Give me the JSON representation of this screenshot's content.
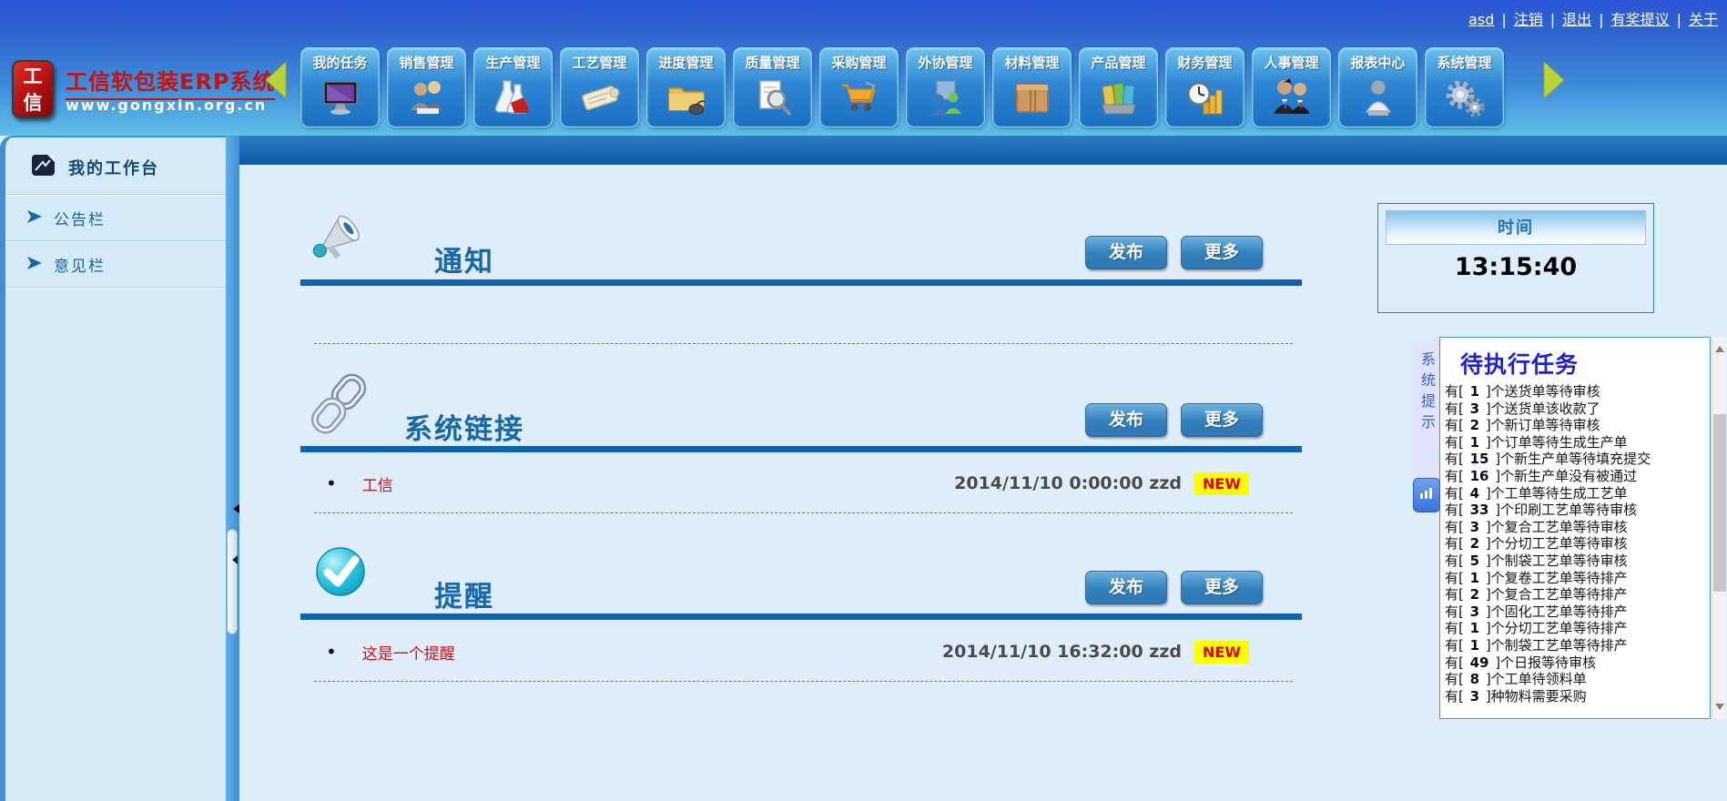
{
  "topbar": {
    "links": [
      "asd",
      "注销",
      "退出",
      "有奖提议",
      "关于"
    ]
  },
  "brand": {
    "logo_line1": "工",
    "logo_line2": "信",
    "title": "工信软包装ERP系统",
    "url": "www.gongxin.org.cn"
  },
  "menu": {
    "items": [
      {
        "label": "我的任务",
        "icon": "monitor-icon"
      },
      {
        "label": "销售管理",
        "icon": "sales-people-icon"
      },
      {
        "label": "生产管理",
        "icon": "flasks-icon"
      },
      {
        "label": "工艺管理",
        "icon": "scroll-icon"
      },
      {
        "label": "进度管理",
        "icon": "folder-mouse-icon"
      },
      {
        "label": "质量管理",
        "icon": "magnifier-doc-icon"
      },
      {
        "label": "采购管理",
        "icon": "cart-icon"
      },
      {
        "label": "外协管理",
        "icon": "partners-icon"
      },
      {
        "label": "材料管理",
        "icon": "box-icon"
      },
      {
        "label": "产品管理",
        "icon": "folders-icon"
      },
      {
        "label": "财务管理",
        "icon": "clock-coins-icon"
      },
      {
        "label": "人事管理",
        "icon": "people-icon"
      },
      {
        "label": "报表中心",
        "icon": "report-person-icon"
      },
      {
        "label": "系统管理",
        "icon": "gears-icon"
      }
    ]
  },
  "sidebar": {
    "title": "我的工作台",
    "items": [
      {
        "label": "公告栏"
      },
      {
        "label": "意见栏"
      }
    ]
  },
  "sections": [
    {
      "title": "通知",
      "icon": "megaphone-icon",
      "publish_label": "发布",
      "more_label": "更多",
      "entries": []
    },
    {
      "title": "系统链接",
      "icon": "chain-icon",
      "publish_label": "发布",
      "more_label": "更多",
      "entries": [
        {
          "bullet": "•",
          "text": "工信",
          "meta": "2014/11/10 0:00:00 zzd",
          "badge": "NEW"
        }
      ]
    },
    {
      "title": "提醒",
      "icon": "check-icon",
      "publish_label": "发布",
      "more_label": "更多",
      "entries": [
        {
          "bullet": "•",
          "text": "这是一个提醒",
          "meta": "2014/11/10 16:32:00 zzd",
          "badge": "NEW"
        }
      ]
    }
  ],
  "time_panel": {
    "title": "时间",
    "value": "13:15:40"
  },
  "tasks_panel": {
    "tab": "系统提示",
    "title": "待执行任务",
    "item_prefix": "有[",
    "item_suffix": "]",
    "items": [
      {
        "count": "1",
        "text": "个送货单等待审核"
      },
      {
        "count": "3",
        "text": "个送货单该收款了"
      },
      {
        "count": "2",
        "text": "个新订单等待审核"
      },
      {
        "count": "1",
        "text": "个订单等待生成生产单"
      },
      {
        "count": "15",
        "text": "个新生产单等待填充提交"
      },
      {
        "count": "16",
        "text": "个新生产单没有被通过"
      },
      {
        "count": "4",
        "text": "个工单等待生成工艺单"
      },
      {
        "count": "33",
        "text": "个印刷工艺单等待审核"
      },
      {
        "count": "3",
        "text": "个复合工艺单等待审核"
      },
      {
        "count": "2",
        "text": "个分切工艺单等待审核"
      },
      {
        "count": "5",
        "text": "个制袋工艺单等待审核"
      },
      {
        "count": "1",
        "text": "个复卷工艺单等待排产"
      },
      {
        "count": "2",
        "text": "个复合工艺单等待排产"
      },
      {
        "count": "3",
        "text": "个固化工艺单等待排产"
      },
      {
        "count": "1",
        "text": "个分切工艺单等待排产"
      },
      {
        "count": "1",
        "text": "个制袋工艺单等待排产"
      },
      {
        "count": "49",
        "text": "个日报等待审核"
      },
      {
        "count": "8",
        "text": "个工单待领料单"
      },
      {
        "count": "3",
        "text": "种物料需要采购"
      }
    ]
  },
  "colors": {
    "accent_blue": "#1568ae",
    "rule_blue": "#0f62ad",
    "badge_bg": "#ffff00",
    "badge_text": "#e00000",
    "red_text": "#c51212",
    "brand_red": "#c51212"
  }
}
